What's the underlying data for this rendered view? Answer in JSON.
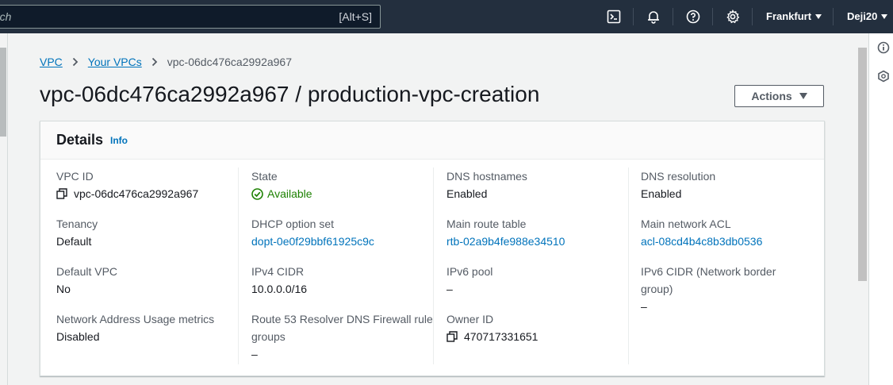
{
  "topbar": {
    "search_text": "rch",
    "search_shortcut": "[Alt+S]",
    "region": "Frankfurt",
    "account": "Deji20"
  },
  "icons": {
    "cloudshell": "terminal-icon",
    "notifications": "bell-icon",
    "help": "help-circle-icon",
    "settings": "gear-icon",
    "info_rail": "info-circle-icon",
    "rail_2": "hexagon-icon"
  },
  "breadcrumb": {
    "items": [
      "VPC",
      "Your VPCs",
      "vpc-06dc476ca2992a967"
    ]
  },
  "page": {
    "title": "vpc-06dc476ca2992a967 / production-vpc-creation",
    "actions_label": "Actions"
  },
  "details": {
    "title": "Details",
    "info_label": "Info",
    "columns": [
      [
        {
          "label": "VPC ID",
          "value": "vpc-06dc476ca2992a967"
        },
        {
          "label": "Tenancy",
          "value": "Default"
        },
        {
          "label": "Default VPC",
          "value": "No"
        },
        {
          "label": "Network Address Usage metrics",
          "value": "Disabled"
        }
      ],
      [
        {
          "label": "State",
          "value": "Available"
        },
        {
          "label": "DHCP option set",
          "value": "dopt-0e0f29bbf61925c9c"
        },
        {
          "label": "IPv4 CIDR",
          "value": "10.0.0.0/16"
        },
        {
          "label": "Route 53 Resolver DNS Firewall rule groups",
          "value": "–"
        }
      ],
      [
        {
          "label": "DNS hostnames",
          "value": "Enabled"
        },
        {
          "label": "Main route table",
          "value": "rtb-02a9b4fe988e34510"
        },
        {
          "label": "IPv6 pool",
          "value": "–"
        },
        {
          "label": "Owner ID",
          "value": "470717331651"
        }
      ],
      [
        {
          "label": "DNS resolution",
          "value": "Enabled"
        },
        {
          "label": "Main network ACL",
          "value": "acl-08cd4b4c8b3db0536"
        },
        {
          "label": "IPv6 CIDR (Network border group)",
          "value": "–"
        }
      ]
    ]
  },
  "colors": {
    "nav_bg": "#232f3e",
    "link": "#0073bb",
    "status_ok": "#1d8102"
  }
}
